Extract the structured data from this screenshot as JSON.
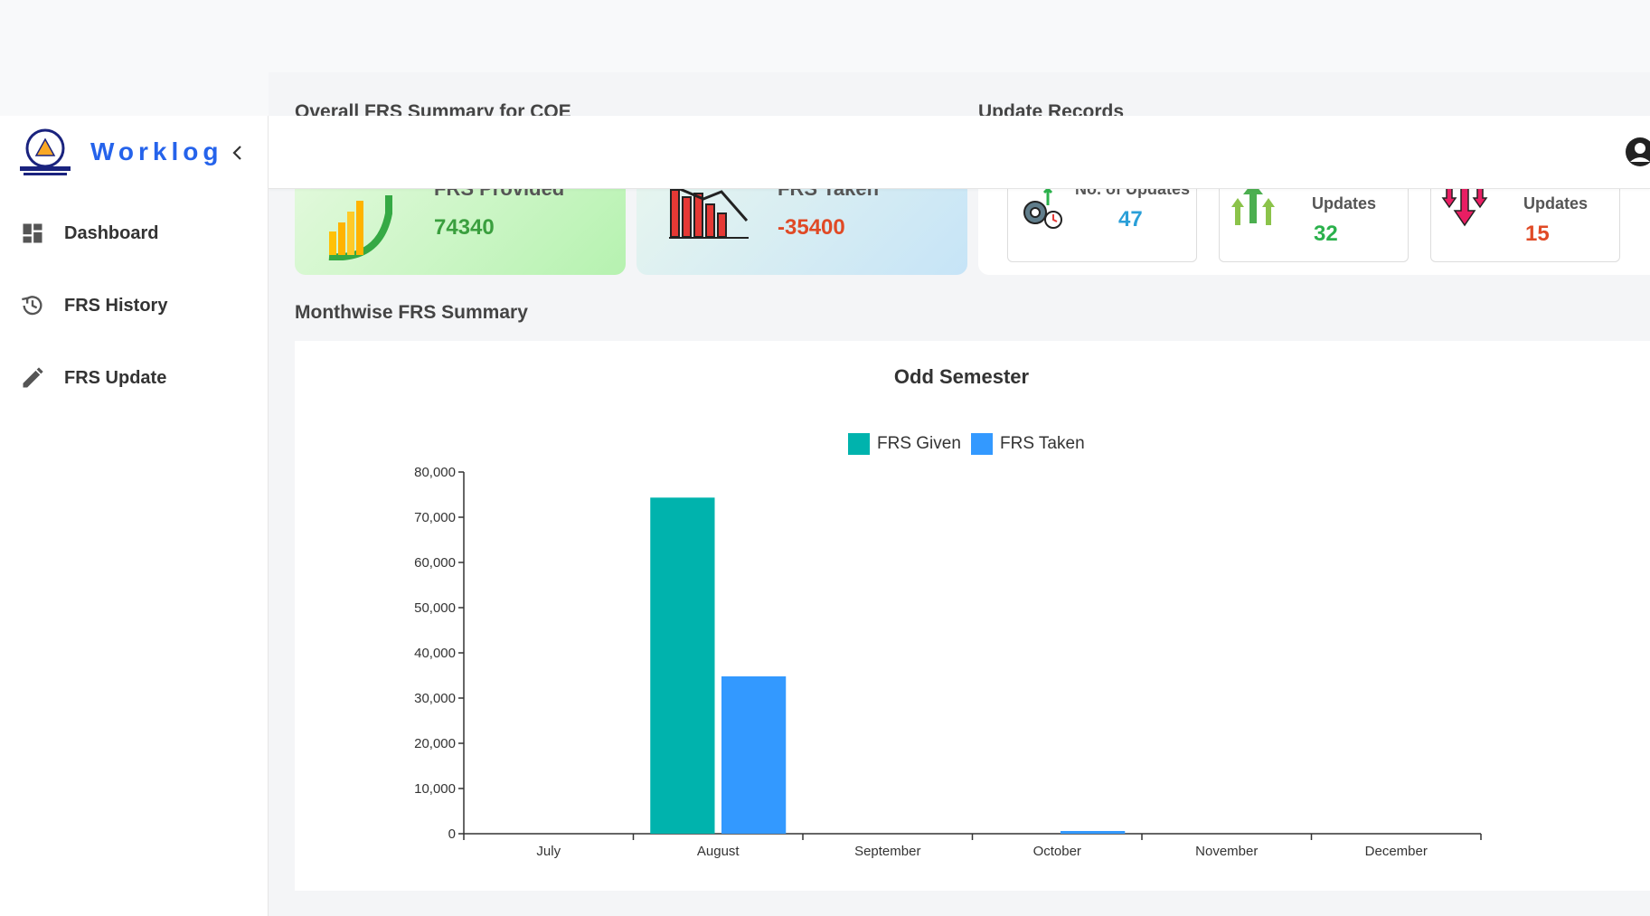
{
  "app": {
    "brand": "Worklog"
  },
  "sidebar": {
    "items": [
      {
        "label": "Dashboard",
        "icon": "dashboard-icon"
      },
      {
        "label": "FRS History",
        "icon": "history-icon"
      },
      {
        "label": "FRS Update",
        "icon": "edit-icon"
      }
    ]
  },
  "summary": {
    "title": "Overall FRS Summary for COE",
    "provided": {
      "label": "FRS Provided",
      "value": "74340",
      "color": "#3a9f3e"
    },
    "taken": {
      "label": "FRS Taken",
      "value": "-35400",
      "color": "#e04a26"
    }
  },
  "updates": {
    "title": "Update Records",
    "total": {
      "label": "No. of Updates",
      "value": "47",
      "color": "#2a9fd8"
    },
    "positive": {
      "label": "Updates",
      "value": "32",
      "color": "#2bb14c"
    },
    "negative": {
      "label": "Updates",
      "value": "15",
      "color": "#e04a26"
    }
  },
  "monthwise": {
    "title": "Monthwise FRS Summary"
  },
  "chart_data": {
    "type": "bar",
    "title": "Odd Semester",
    "categories": [
      "July",
      "August",
      "September",
      "October",
      "November",
      "December"
    ],
    "series": [
      {
        "name": "FRS Given",
        "color": "#00b3ad",
        "values": [
          0,
          74340,
          0,
          0,
          0,
          0
        ]
      },
      {
        "name": "FRS Taken",
        "color": "#3399ff",
        "values": [
          0,
          34800,
          0,
          600,
          0,
          0
        ]
      }
    ],
    "yticks": [
      "0",
      "10,000",
      "20,000",
      "30,000",
      "40,000",
      "50,000",
      "60,000",
      "70,000",
      "80,000"
    ],
    "ylim": [
      0,
      80000
    ],
    "legend": "top-center",
    "grid": false
  }
}
